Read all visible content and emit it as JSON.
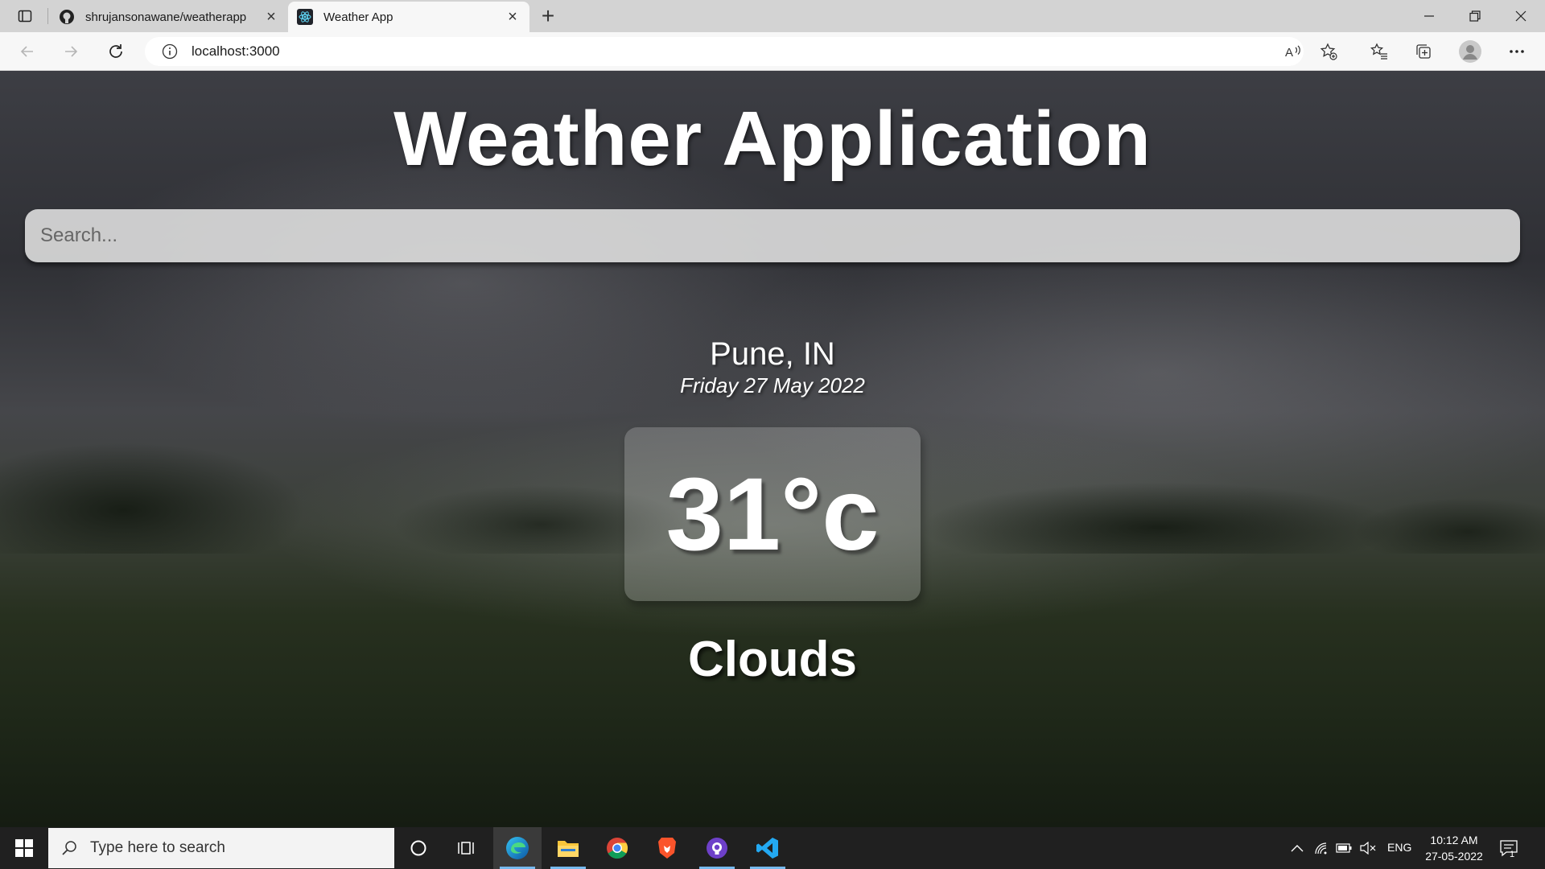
{
  "browser": {
    "tabs": [
      {
        "title": "shrujansonawane/weatherapp",
        "favicon": "github-icon"
      },
      {
        "title": "Weather App",
        "favicon": "react-icon",
        "active": true
      }
    ],
    "address": "localhost:3000"
  },
  "app": {
    "title": "Weather Application",
    "search_placeholder": "Search...",
    "location": "Pune, IN",
    "date": "Friday 27 May 2022",
    "temperature": "31°c",
    "condition": "Clouds"
  },
  "taskbar": {
    "search_placeholder": "Type here to search",
    "apps": [
      "cortana-icon",
      "task-view-icon",
      "edge-icon",
      "file-explorer-icon",
      "chrome-icon",
      "brave-icon",
      "github-desktop-icon",
      "vscode-icon"
    ],
    "language": "ENG",
    "time": "10:12 AM",
    "date": "27-05-2022",
    "notification_count": "1"
  }
}
